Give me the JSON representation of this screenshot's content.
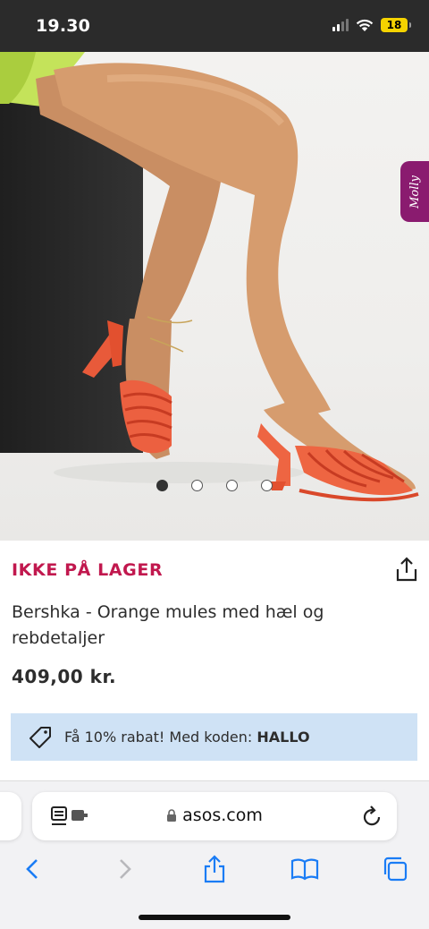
{
  "status_bar": {
    "time": "19.30",
    "battery": "18"
  },
  "product": {
    "stock_status": "IKKE PÅ LAGER",
    "name": "Bershka - Orange mules med hæl og rebdetaljer",
    "price": "409,00 kr."
  },
  "carousel": {
    "total": 4,
    "active": 1
  },
  "side_tab": {
    "label": "Molly"
  },
  "promo": {
    "text": "Få 10% rabat! Med koden: ",
    "code": "HALLO"
  },
  "browser": {
    "url": "asos.com"
  },
  "colors": {
    "stock": "#c1184e",
    "promo_bg": "#cfe2f5",
    "ios_blue": "#1a7cf5",
    "molly": "#8a1b6f"
  },
  "icons": [
    "share-icon",
    "tag-icon",
    "reader-icon",
    "lock-icon",
    "reload-icon",
    "back-icon",
    "forward-icon",
    "share-sheet-icon",
    "bookmarks-icon",
    "tabs-icon"
  ]
}
